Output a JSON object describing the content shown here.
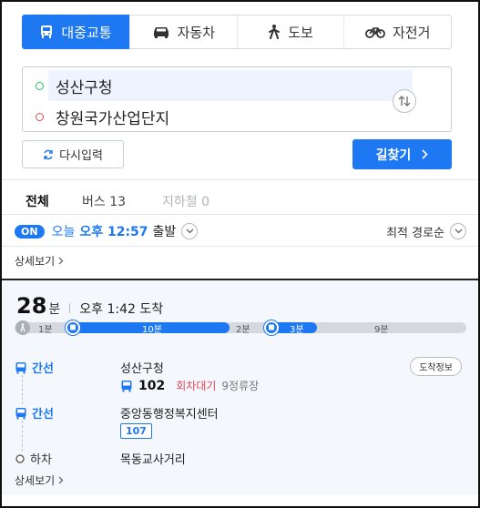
{
  "modes": [
    {
      "label": "대중교통",
      "icon": "bus-icon",
      "active": true
    },
    {
      "label": "자동차",
      "icon": "car-icon",
      "active": false
    },
    {
      "label": "도보",
      "icon": "walk-icon",
      "active": false
    },
    {
      "label": "자전거",
      "icon": "bike-icon",
      "active": false
    }
  ],
  "route": {
    "origin": "성산구청",
    "destination": "창원국가산업단지"
  },
  "actions": {
    "reset_label": "다시입력",
    "search_label": "길찾기"
  },
  "tabs": {
    "all": "전체",
    "bus": "버스 13",
    "subway": "지하철 0"
  },
  "departure": {
    "badge": "ON",
    "day": "오늘",
    "time": "오후 12:57",
    "suffix": "출발",
    "sort_label": "최적 경로순"
  },
  "detail_label": "상세보기",
  "result": {
    "minutes": "28",
    "minutes_unit": "분",
    "arrival": "오후 1:42 도착",
    "timeline": {
      "walk1": "1분",
      "bus1": "10분",
      "walk2": "2분",
      "bus2": "3분",
      "walk3": "9분"
    },
    "steps": [
      {
        "kind": "간선",
        "stop": "성산구청",
        "bus_number": "102",
        "wait": "회차대기",
        "stop_count": "9정류장"
      },
      {
        "kind": "간선",
        "stop": "중앙동행정복지센터",
        "bus_number": "107"
      },
      {
        "kind": "하차",
        "stop": "목동교사거리"
      }
    ],
    "arrival_info_label": "도착정보",
    "detail_label": "상세보기"
  },
  "colors": {
    "accent": "#1d78f2",
    "origin_dot": "#2cbf6a",
    "dest_dot": "#e4495a",
    "wait_text": "#e4495a"
  }
}
